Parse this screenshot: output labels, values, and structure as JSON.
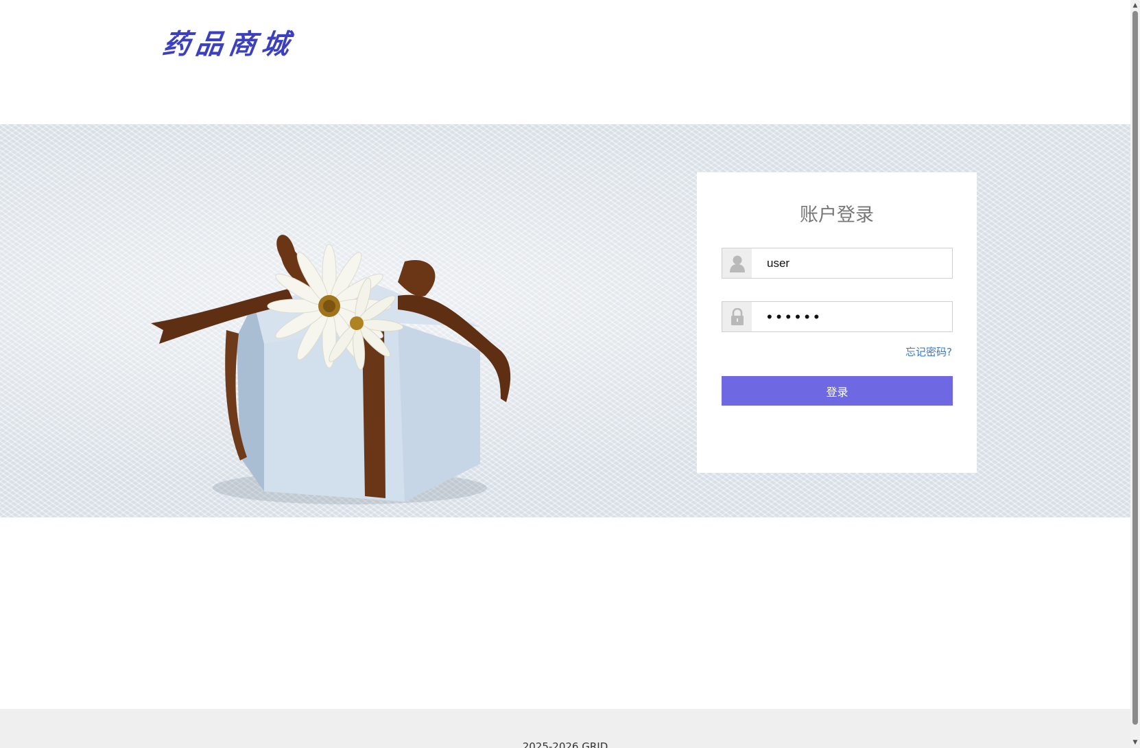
{
  "header": {
    "logo_text": "药品商城"
  },
  "banner": {
    "image": "gift-box-with-daisy"
  },
  "login": {
    "title": "账户登录",
    "username": {
      "value": "user",
      "icon": "user-icon"
    },
    "password": {
      "value": "123456",
      "icon": "lock-icon"
    },
    "forgot_label": "忘记密码?",
    "submit_label": "登录"
  },
  "footer": {
    "text": "2025-2026 GRID"
  },
  "colors": {
    "logo": "#3b3fc2",
    "button": "#6f68e3",
    "link": "#3a78c3",
    "footer_bg": "#efefef"
  }
}
